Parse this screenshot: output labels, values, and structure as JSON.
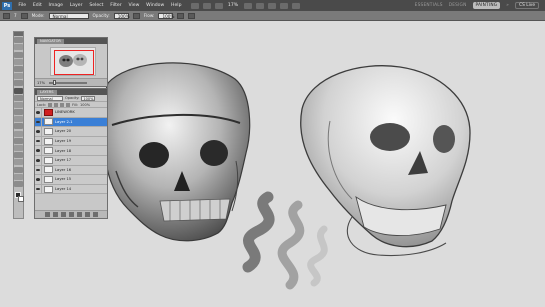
{
  "menubar": {
    "logo": "Ps",
    "items": [
      "File",
      "Edit",
      "Image",
      "Layer",
      "Select",
      "Filter",
      "View",
      "Window",
      "Help"
    ],
    "zoom": "17%",
    "workspaces": [
      "ESSENTIALS",
      "DESIGN",
      "PAINTING"
    ],
    "active_workspace": "PAINTING",
    "more": "»",
    "cs_live": "CS Live"
  },
  "options": {
    "brush_size": "7",
    "mode_label": "Mode:",
    "mode_value": "Normal",
    "opacity_label": "Opacity:",
    "opacity_value": "100%",
    "flow_label": "Flow:",
    "flow_value": "100%"
  },
  "navigator": {
    "title": "NAVIGATOR",
    "zoom": "17%"
  },
  "layers": {
    "title": "LAYERS",
    "blend_mode": "Normal",
    "opacity_label": "Opacity:",
    "opacity_value": "100%",
    "lock_label": "Lock:",
    "fill_label": "Fill:",
    "fill_value": "100%",
    "items": [
      {
        "name": "LINEWORK",
        "state": "red"
      },
      {
        "name": "Layer 2-1",
        "state": "active"
      },
      {
        "name": "Layer 20",
        "state": ""
      },
      {
        "name": "Layer 19",
        "state": ""
      },
      {
        "name": "Layer 18",
        "state": ""
      },
      {
        "name": "Layer 17",
        "state": ""
      },
      {
        "name": "Layer 16",
        "state": ""
      },
      {
        "name": "Layer 15",
        "state": ""
      },
      {
        "name": "Layer 14",
        "state": ""
      }
    ]
  },
  "colors": {
    "menubar_bg": "#4a4a4a",
    "options_bg": "#7a7a7a",
    "canvas_bg": "#dcdcdc",
    "selected_layer": "#3a7fd6",
    "navigator_frame": "#ee2222"
  }
}
